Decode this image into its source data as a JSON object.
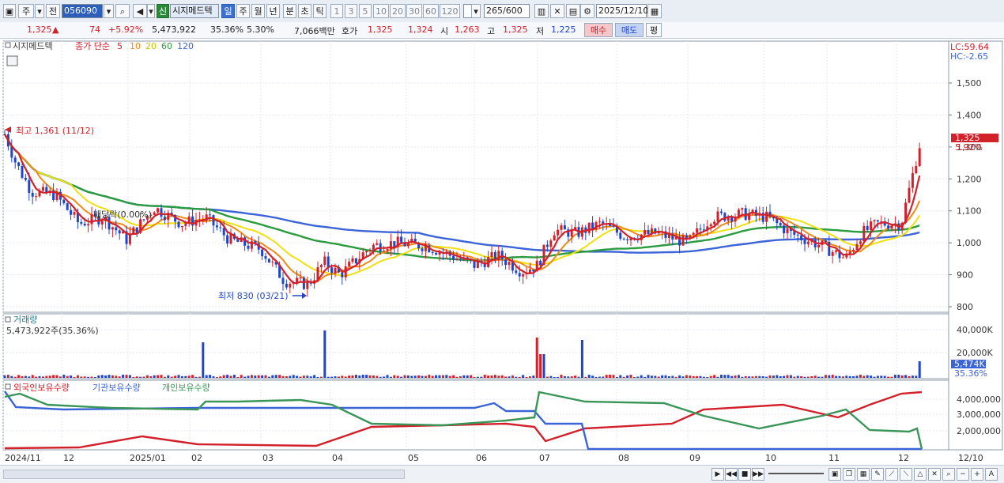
{
  "toolbar": {
    "period_main": "주",
    "prev_label": "전",
    "code": "056090",
    "credit_badge": "신",
    "name": "시지메드텍",
    "periods": [
      "일",
      "주",
      "월",
      "년",
      "분",
      "초",
      "틱"
    ],
    "active_period": "일",
    "minutes": [
      "1",
      "3",
      "5",
      "10",
      "20",
      "30",
      "60",
      "120"
    ],
    "count": "265",
    "count_total": "/600",
    "date": "2025/12/10"
  },
  "quote": {
    "price": "1,325",
    "arrow": "▲",
    "change": "74",
    "change_pct": "+5.92%",
    "volume": "5,473,922",
    "volume_ratio": "35.36%",
    "turnover": "5.30%",
    "amount": "7,066백만",
    "ask_label": "호가",
    "ask": "1,325",
    "bid": "1,324",
    "open_label": "시",
    "open": "1,263",
    "high_label": "고",
    "high": "1,325",
    "low_label": "저",
    "low": "1,225",
    "buy_label": "매수",
    "sell_label": "매도",
    "eval_label": "평"
  },
  "price_panel": {
    "stock_label": "시지메드텍",
    "ma_prefix": "종가 단순",
    "ma_periods": [
      "5",
      "10",
      "20",
      "60",
      "120"
    ],
    "lc": "LC:59.64",
    "hc": "HC:-2.65",
    "high_note": "최고 1,361 (11/12)",
    "low_note": "최저 830 (03/21)",
    "dividend_note": "배당락(0.00%)",
    "current_price_tag": "1,325",
    "current_pct_tag": "5.92%",
    "y_ticks": [
      "1,500",
      "1,400",
      "1,300",
      "1,200",
      "1,100",
      "1,000",
      "900",
      "800"
    ]
  },
  "volume_panel": {
    "title": "거래량",
    "info": "5,473,922주(35.36%)",
    "y_ticks": [
      "40,000K",
      "20,000K"
    ],
    "tag": "5,474K",
    "tag_pct": "35.36%"
  },
  "holding_panel": {
    "legend": [
      "외국인보유수량",
      "기관보유수량",
      "개인보유수량"
    ],
    "y_ticks": [
      "4,000,000",
      "3,000,000",
      "2,000,000"
    ]
  },
  "x_axis": [
    "2024/11",
    "12",
    "2025/01",
    "02",
    "03",
    "04",
    "05",
    "06",
    "07",
    "08",
    "09",
    "10",
    "11",
    "12",
    "12/10"
  ],
  "colors": {
    "up": "#d3212c",
    "down": "#1f46c9",
    "ma5": "#d3212c",
    "ma10": "#f08a16",
    "ma20": "#f0e010",
    "ma60": "#2a9b3e",
    "ma120": "#3a64d8",
    "foreign": "#d3212c",
    "institution": "#3a64d8",
    "individual": "#3a9558"
  }
}
